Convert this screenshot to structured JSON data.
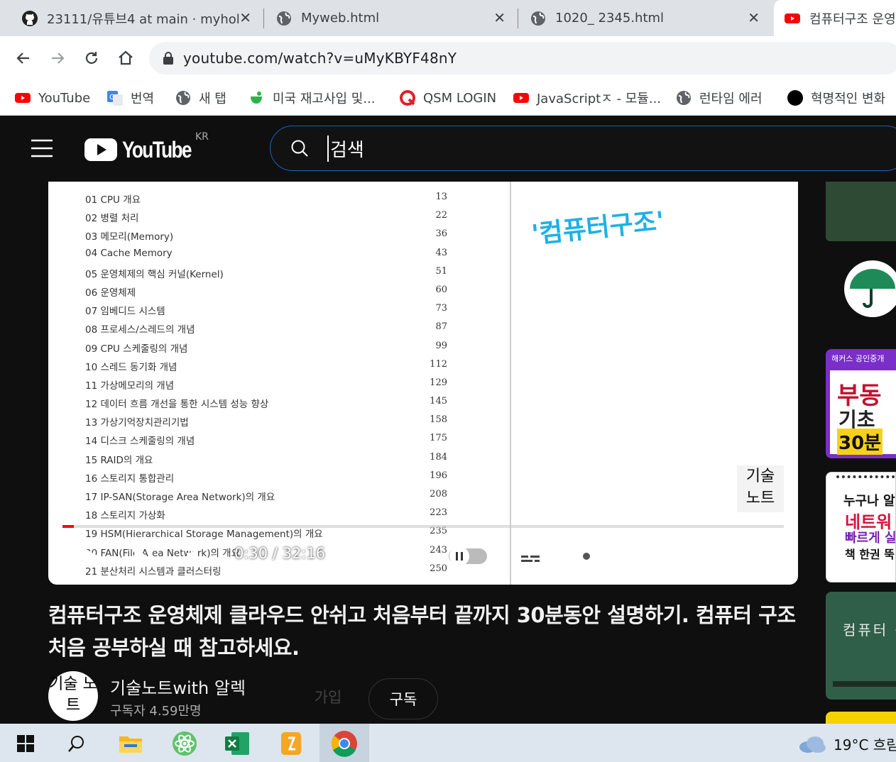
{
  "browser": {
    "tabs": [
      {
        "title": "23111/유튜브4 at main · myhol"
      },
      {
        "title": "Myweb.html"
      },
      {
        "title": "1020_ 2345.html"
      },
      {
        "title": "컴퓨터구조 운영"
      }
    ],
    "url": "youtube.com/watch?v=uMyKBYF48nY",
    "bookmarks": [
      {
        "label": "YouTube"
      },
      {
        "label": "번역"
      },
      {
        "label": "새 탭"
      },
      {
        "label": "미국 재고사입 및..."
      },
      {
        "label": "QSM LOGIN"
      },
      {
        "label": "JavaScriptㅈ - 모듈..."
      },
      {
        "label": "런타임 에러"
      },
      {
        "label": "혁명적인 변화"
      }
    ]
  },
  "youtube": {
    "logo_text": "YouTube",
    "region": "KR",
    "search_placeholder": "검색"
  },
  "video": {
    "toc": [
      {
        "title": "01 CPU 개요",
        "page": "13"
      },
      {
        "title": "02 병렬 처리",
        "page": "22"
      },
      {
        "title": "03 메모리(Memory)",
        "page": "36"
      },
      {
        "title": "04 Cache Memory",
        "page": "43"
      },
      {
        "title": "05 운영체제의 핵심 커널(Kernel)",
        "page": "51"
      },
      {
        "title": "06 운영체제",
        "page": "60"
      },
      {
        "title": "07 임베디드 시스템",
        "page": "73"
      },
      {
        "title": "08 프로세스/스레드의 개념",
        "page": "87"
      },
      {
        "title": "09 CPU 스케줄링의 개념",
        "page": "99"
      },
      {
        "title": "10 스레드 동기화 개념",
        "page": "112"
      },
      {
        "title": "11 가상메모리의 개념",
        "page": "129"
      },
      {
        "title": "12 데이터 흐름 개선을 통한 시스템 성능 향상",
        "page": "145"
      },
      {
        "title": "13 가상기억장치관리기법",
        "page": "158"
      },
      {
        "title": "14 디스크 스케줄링의 개념",
        "page": "175"
      },
      {
        "title": "15 RAID의 개요",
        "page": "184"
      },
      {
        "title": "16 스토리지 통합관리",
        "page": "196"
      },
      {
        "title": "17 IP-SAN(Storage Area Network)의 개요",
        "page": "208"
      },
      {
        "title": "18 스토리지 가상화",
        "page": "223"
      },
      {
        "title": "19 HSM(Hierarchical Storage Management)의 개요",
        "page": "235"
      },
      {
        "title": "20 FAN(File Area Network)의 개요",
        "page": "243"
      },
      {
        "title": "21 분산처리 시스템과 클러스터링",
        "page": "250"
      }
    ],
    "handwriting": "'컴퓨터구조'",
    "watermark": "기술 노트",
    "time": "0:30 / 32:16",
    "progress_fraction": 0.0155,
    "title": "컴퓨터구조 운영체제 클라우드 안쉬고 처음부터 끝까지 30분동안 설명하기. 컴퓨터 구조 처음 공부하실 때 참고하세요.",
    "channel": {
      "avatar_text": "기술 노트",
      "name": "기술노트with 알렉",
      "subscribers": "구독자 4.59만명",
      "join_label": "가입",
      "subscribe_label": "구독"
    }
  },
  "sidebar": {
    "ad1_header": "해커스 공인중개",
    "ad1_line1": "부동",
    "ad1_line2": "기초",
    "ad1_line3": "30분",
    "ad2_line1": "누구나 알",
    "ad2_line2": "네트워",
    "ad2_line3": "빠르게 실",
    "ad2_line4": "책 한권 뚝",
    "thumb3_text": "컴퓨터 구"
  },
  "taskbar": {
    "weather": "19°C 흐림"
  },
  "colors": {
    "youtube_red": "#ff0000",
    "search_border": "#1c62b9",
    "tabbar": "#dee1e6",
    "taskbar": "#dde6ee"
  }
}
